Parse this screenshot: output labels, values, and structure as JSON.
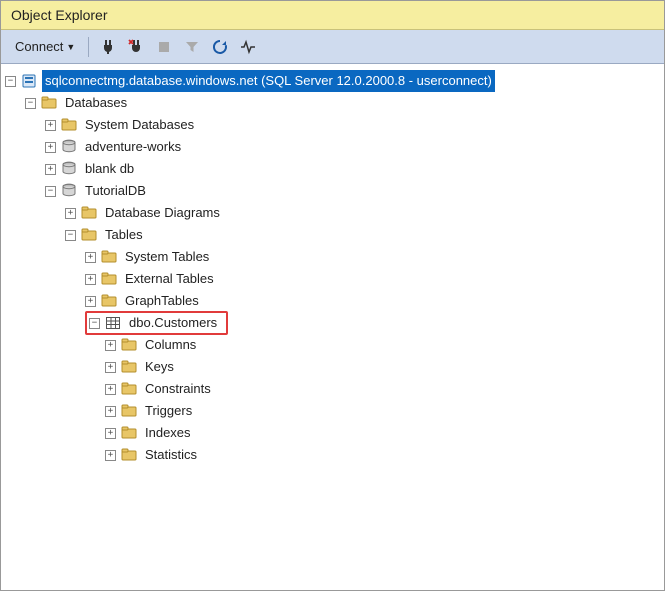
{
  "window": {
    "title": "Object Explorer"
  },
  "toolbar": {
    "connect_label": "Connect",
    "icons": [
      "plug",
      "plug-x",
      "stop",
      "filter",
      "refresh",
      "activity"
    ]
  },
  "tree": {
    "server": {
      "label": "sqlconnectmg.database.windows.net (SQL Server 12.0.2000.8 - userconnect)",
      "expanded": true,
      "selected": true
    },
    "databases": {
      "label": "Databases",
      "expanded": true,
      "children": [
        {
          "key": "sysdb",
          "label": "System Databases",
          "icon": "folder",
          "expanded": false
        },
        {
          "key": "adv",
          "label": "adventure-works",
          "icon": "db",
          "expanded": false
        },
        {
          "key": "blank",
          "label": "blank db",
          "icon": "db",
          "expanded": false
        },
        {
          "key": "tut",
          "label": "TutorialDB",
          "icon": "db",
          "expanded": true
        }
      ]
    },
    "tutorialdb": {
      "diagrams": {
        "label": "Database Diagrams",
        "expanded": false
      },
      "tables": {
        "label": "Tables",
        "expanded": true
      }
    },
    "tables_children": [
      {
        "label": "System Tables",
        "expanded": false
      },
      {
        "label": "External Tables",
        "expanded": false
      },
      {
        "label": "GraphTables",
        "expanded": false
      }
    ],
    "customers": {
      "label": "dbo.Customers",
      "expanded": true,
      "highlighted": true
    },
    "customers_children": [
      {
        "label": "Columns"
      },
      {
        "label": "Keys"
      },
      {
        "label": "Constraints"
      },
      {
        "label": "Triggers"
      },
      {
        "label": "Indexes"
      },
      {
        "label": "Statistics"
      }
    ]
  }
}
